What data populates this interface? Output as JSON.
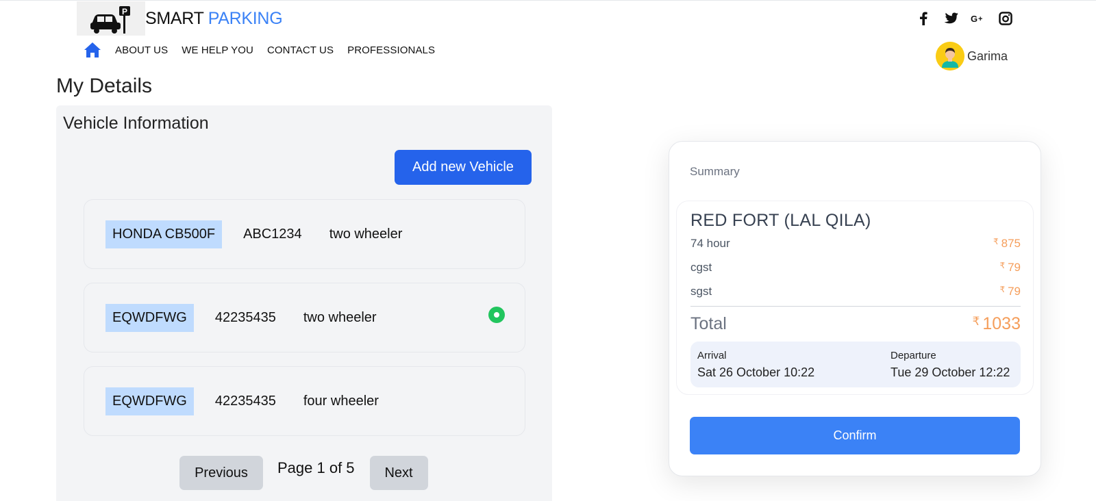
{
  "brand": {
    "part1": "SMART",
    "part2": "PARKING"
  },
  "nav": {
    "items": [
      {
        "label": "ABOUT US"
      },
      {
        "label": "WE HELP YOU"
      },
      {
        "label": "CONTACT US"
      },
      {
        "label": "PROFESSIONALS"
      }
    ]
  },
  "social": [
    "facebook-icon",
    "twitter-icon",
    "google-plus-icon",
    "instagram-icon"
  ],
  "user": {
    "name": "Garima"
  },
  "page": {
    "title": "My Details"
  },
  "vehicles": {
    "title": "Vehicle Information",
    "add_label": "Add new Vehicle",
    "items": [
      {
        "model": "HONDA CB500F",
        "plate": "ABC1234",
        "type": "two wheeler",
        "selected": false
      },
      {
        "model": "EQWDFWG",
        "plate": "42235435",
        "type": "two wheeler",
        "selected": true
      },
      {
        "model": "EQWDFWG",
        "plate": "42235435",
        "type": "four wheeler",
        "selected": false
      }
    ],
    "pager": {
      "prev": "Previous",
      "info": "Page 1 of 5",
      "next": "Next"
    }
  },
  "summary": {
    "label": "Summary",
    "place": "RED FORT (LAL QILA)",
    "currency": "₹",
    "lines": [
      {
        "label": "74 hour",
        "value": "875"
      },
      {
        "label": "cgst",
        "value": "79"
      },
      {
        "label": "sgst",
        "value": "79"
      }
    ],
    "total_label": "Total",
    "total_value": "1033",
    "arrival_label": "Arrival",
    "arrival_value": "Sat 26 October 10:22",
    "departure_label": "Departure",
    "departure_value": "Tue 29 October 12:22",
    "confirm_label": "Confirm"
  },
  "colors": {
    "accent": "#2563eb",
    "price": "#f59e5b",
    "selected": "#22c55e"
  }
}
